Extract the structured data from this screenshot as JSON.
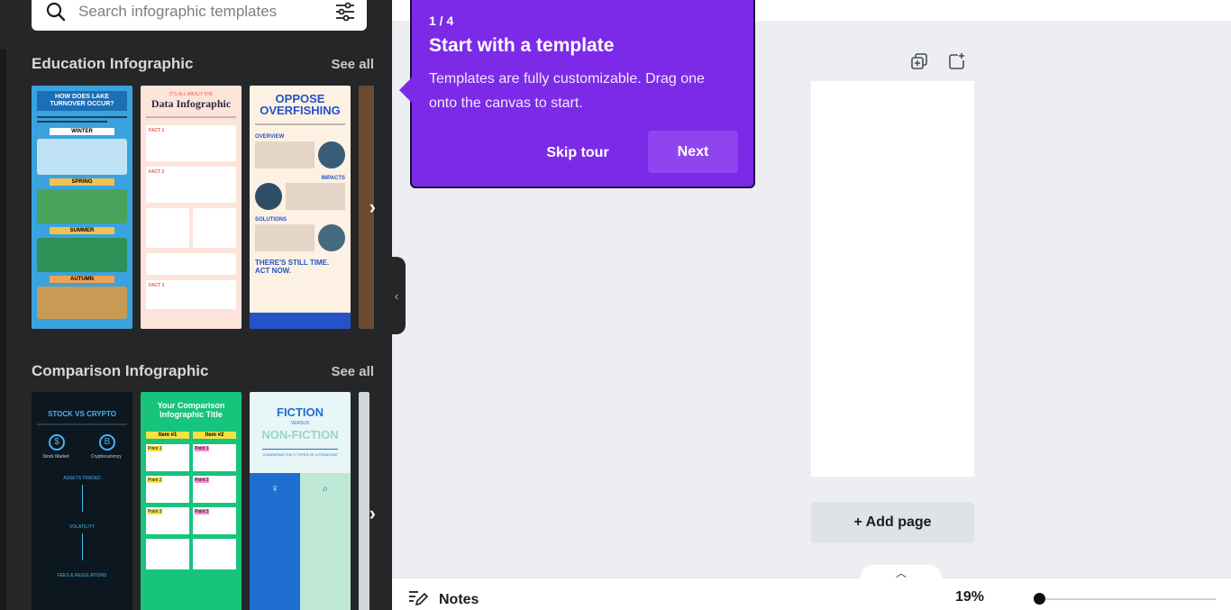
{
  "search": {
    "placeholder": "Search infographic templates",
    "icon": "search-icon",
    "filter_icon": "filter-sliders-icon"
  },
  "sections": [
    {
      "title": "Education Infographic",
      "see_all": "See all",
      "templates": [
        {
          "heading": "HOW DOES LAKE TURNOVER OCCUR?",
          "labels": [
            "WINTER",
            "SPRING",
            "SUMMER",
            "AUTUMN"
          ],
          "colors": {
            "bg": "#3aa2de",
            "accent": "#f2c24f"
          }
        },
        {
          "heading": "Data Infographic",
          "kicker": "IT'S ALL ABOUT THE",
          "labels": [
            "FACT 1",
            "FACT 2",
            "FACT 3"
          ],
          "colors": {
            "bg": "#fde4da",
            "accent": "#e65b47"
          }
        },
        {
          "heading": "OPPOSE OVERFISHING",
          "labels": [
            "OVERVIEW",
            "IMPACTS",
            "SOLUTIONS",
            "THERE'S STILL TIME. ACT NOW."
          ],
          "colors": {
            "bg": "#fdf1e4",
            "accent": "#2353c7"
          }
        }
      ]
    },
    {
      "title": "Comparison Infographic",
      "see_all": "See all",
      "templates": [
        {
          "heading": "STOCK VS CRYPTO",
          "labels": [
            "Stock Market",
            "Cryptocurrency",
            "ASSETS TRADED",
            "VOLATILITY",
            "FEES & REGULATIONS"
          ],
          "colors": {
            "bg": "#0d1720",
            "accent": "#45b6f3"
          }
        },
        {
          "heading": "Your Comparison Infographic Title",
          "labels": [
            "Item #1",
            "Item #2",
            "Point 1",
            "Point 1",
            "Point 2",
            "Point 2",
            "Point 3",
            "Point 3"
          ],
          "colors": {
            "bg": "#17c47c",
            "accent": "#f5e142"
          }
        },
        {
          "heading": "FICTION",
          "sub": "VERSUS",
          "heading2": "NON-FICTION",
          "labels": [
            "COMPARING THE 2 TYPES OF LITERATURE"
          ],
          "colors": {
            "bg": "#e9f6f8",
            "accent": "#1f6fd1"
          }
        }
      ]
    }
  ],
  "collapse_icon": "chevron-left-icon",
  "tour": {
    "step": "1 / 4",
    "title": "Start with a template",
    "description": "Templates are fully customizable. Drag one onto the canvas to start.",
    "skip_label": "Skip tour",
    "next_label": "Next"
  },
  "canvas": {
    "add_page": "+ Add page",
    "duplicate_icon": "duplicate-page-icon",
    "add_icon": "add-page-icon"
  },
  "bottom": {
    "notes_label": "Notes",
    "notes_icon": "notes-pencil-icon",
    "zoom": "19%",
    "zoom_level": 0.19,
    "expand_icon": "chevron-up-icon"
  }
}
